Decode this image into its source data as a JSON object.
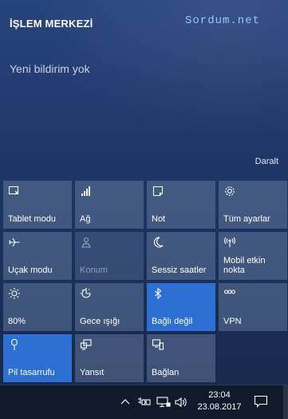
{
  "panel": {
    "title": "İŞLEM MERKEZİ",
    "watermark": "Sordum.net",
    "empty_message": "Yeni bildirim yok",
    "collapse_label": "Daralt"
  },
  "tiles": [
    {
      "label": "Tablet modu",
      "icon": "tablet-mode-icon",
      "state": "off"
    },
    {
      "label": "Ağ",
      "icon": "network-icon",
      "state": "off"
    },
    {
      "label": "Not",
      "icon": "note-icon",
      "state": "off"
    },
    {
      "label": "Tüm ayarlar",
      "icon": "settings-gear-icon",
      "state": "off"
    },
    {
      "label": "Uçak modu",
      "icon": "airplane-icon",
      "state": "off"
    },
    {
      "label": "Konum",
      "icon": "location-icon",
      "state": "disabled"
    },
    {
      "label": "Sessiz saatler",
      "icon": "moon-icon",
      "state": "off"
    },
    {
      "label": "Mobil etkin nokta",
      "icon": "hotspot-icon",
      "state": "off"
    },
    {
      "label": "80%",
      "icon": "brightness-icon",
      "state": "off"
    },
    {
      "label": "Gece ışığı",
      "icon": "night-light-icon",
      "state": "off"
    },
    {
      "label": "Bağlı değil",
      "icon": "bluetooth-icon",
      "state": "active"
    },
    {
      "label": "VPN",
      "icon": "vpn-icon",
      "state": "off"
    },
    {
      "label": "Pil tasarrufu",
      "icon": "battery-saver-icon",
      "state": "active"
    },
    {
      "label": "Yansıt",
      "icon": "project-icon",
      "state": "off"
    },
    {
      "label": "Bağlan",
      "icon": "connect-icon",
      "state": "off"
    }
  ],
  "taskbar": {
    "time": "23:04",
    "date": "23.08.2017",
    "tray_icons": [
      "chevron-up-icon",
      "battery-plug-icon",
      "network-tray-icon",
      "volume-icon"
    ],
    "action_center_icon": "action-center-icon"
  },
  "colors": {
    "accent": "#2d6fd2",
    "tile_off": "#5a6f97",
    "annotation_arrow": "#22c22e"
  }
}
